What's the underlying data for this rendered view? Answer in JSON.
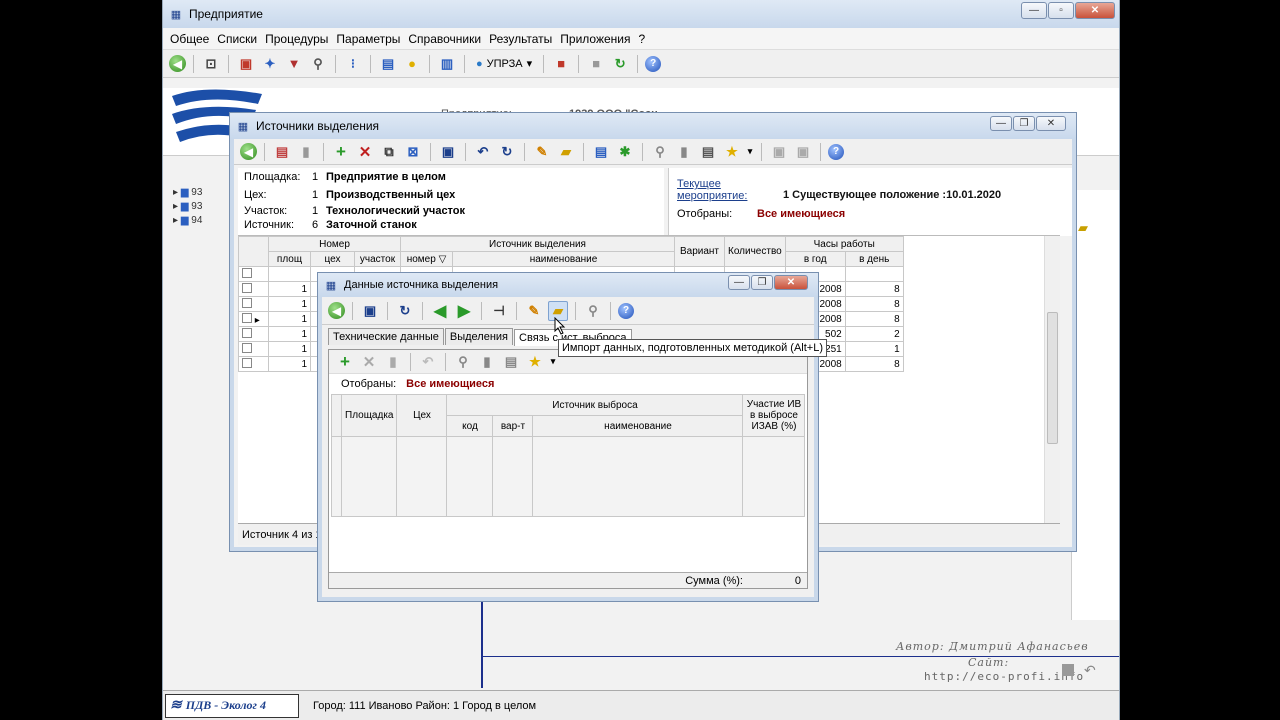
{
  "main": {
    "title": "Предприятие",
    "menu": [
      "Общее",
      "Списки",
      "Процедуры",
      "Параметры",
      "Справочники",
      "Результаты",
      "Приложения",
      "?"
    ],
    "toolbar_dropdown": "УПРЗА",
    "header_label": "Предприятие:",
    "header_value": "1939 ООО \"Сосн",
    "tree_items": [
      "93",
      "93",
      "94"
    ]
  },
  "win1": {
    "title": "Источники выделения",
    "info": {
      "plosh_label": "Площадка:",
      "plosh_num": "1",
      "plosh_val": "Предприятие в целом",
      "ceh_label": "Цех:",
      "ceh_num": "1",
      "ceh_val": "Производственный цех",
      "uch_label": "Участок:",
      "uch_num": "1",
      "uch_val": "Технологический участок",
      "ist_label": "Источник:",
      "ist_num": "6",
      "ist_val": "Заточной станок"
    },
    "event_label": "Текущее мероприятие:",
    "event_value": "1 Существующее положение :10.01.2020",
    "filter_label": "Отобраны:",
    "filter_value": "Все имеющиеся",
    "table": {
      "group_nomer": "Номер",
      "group_source": "Источник выделения",
      "col_variant": "Вариант",
      "col_qty": "Количество",
      "group_hours": "Часы работы",
      "sub": [
        "площ",
        "цех",
        "участок",
        "номер ▽",
        "наименование",
        "в год",
        "в день"
      ],
      "rows": [
        {
          "plosh": "1",
          "year": "2008",
          "day": "8"
        },
        {
          "plosh": "1",
          "year": "2008",
          "day": "8"
        },
        {
          "plosh": "1",
          "year": "2008",
          "day": "8"
        },
        {
          "plosh": "1",
          "year": "502",
          "day": "2"
        },
        {
          "plosh": "1",
          "year": "251",
          "day": "1"
        },
        {
          "plosh": "1",
          "year": "2008",
          "day": "8"
        }
      ]
    },
    "status": "Источник 4 из 1"
  },
  "win2": {
    "title": "Данные источника выделения",
    "tabs": [
      "Технические данные",
      "Выделения",
      "Связь с ист. выброса"
    ],
    "tooltip": "Импорт данных, подготовленных методикой (Alt+L)",
    "filter_label": "Отобраны:",
    "filter_value": "Все имеющиеся",
    "table": {
      "col_plosh": "Площадка",
      "col_ceh": "Цех",
      "group_source": "Источник выброса",
      "col_kod": "код",
      "col_var": "вар-т",
      "col_name": "наименование",
      "col_part": "Участие ИВ в выбросе ИЗАВ (%)"
    },
    "sum_label": "Сумма (%):",
    "sum_value": "0"
  },
  "status_bar": {
    "product": "ПДВ - Эколог 4",
    "text": "Город: 111 Иваново Район: 1 Город в целом"
  },
  "signature": {
    "author": "Автор: Дмитрий Афанасьев",
    "site_label": "Сайт:",
    "site_url": "http://eco-profi.info"
  }
}
